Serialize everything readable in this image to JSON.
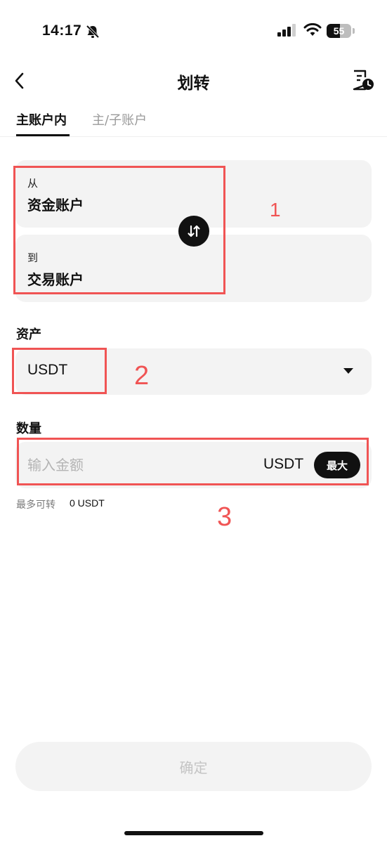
{
  "status_bar": {
    "time": "14:17",
    "battery": "55",
    "battery_level": 0.55
  },
  "nav": {
    "title": "划转"
  },
  "tabs": [
    {
      "label": "主账户内",
      "active": true
    },
    {
      "label": "主/子账户",
      "active": false
    }
  ],
  "transfer": {
    "from_label": "从",
    "from_account": "资金账户",
    "to_label": "到",
    "to_account": "交易账户"
  },
  "asset": {
    "label": "资产",
    "selected": "USDT"
  },
  "amount": {
    "label": "数量",
    "placeholder": "输入金额",
    "value": "",
    "unit": "USDT",
    "max_label": "最大",
    "available_label": "最多可转",
    "available_value": "0 USDT"
  },
  "annotations": {
    "one": "1",
    "two": "2",
    "three": "3",
    "color": "#f05454"
  },
  "confirm_label": "确定"
}
